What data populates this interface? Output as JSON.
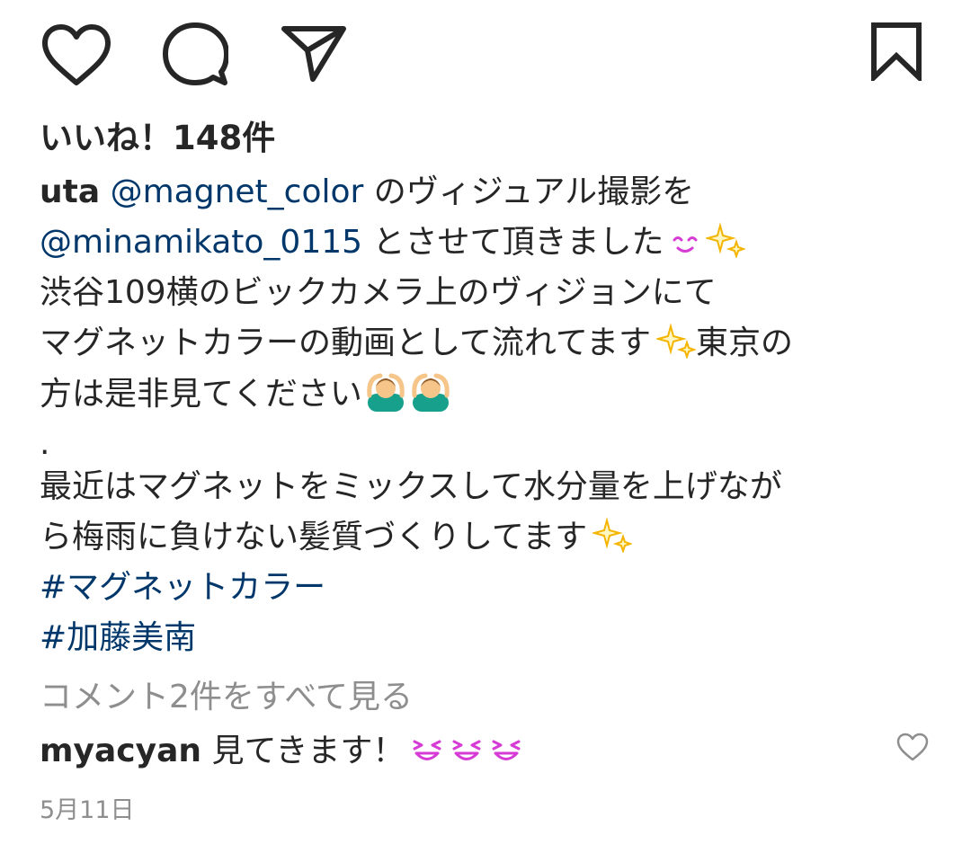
{
  "likes": {
    "text": "いいね！148件"
  },
  "post": {
    "author": "uta",
    "caption_lines": [
      {
        "parts": [
          {
            "type": "mention",
            "text": " @magnet_color"
          },
          {
            "type": "text",
            "text": " のヴィジュアル撮影を"
          }
        ]
      },
      {
        "parts": [
          {
            "type": "mention",
            "text": "@minamikato_0115"
          },
          {
            "type": "text",
            "text": " とさせて頂きました"
          }
        ]
      },
      {
        "text": "渋谷109横のビックカメラ上のヴィジョンにて"
      },
      {
        "text": "マグネットカラーの動画として流れてます"
      },
      {
        "text_after": "東京の"
      },
      {
        "text": "方は是非見てください"
      },
      {
        "text": "."
      },
      {
        "text": "最近はマグネットをミックスして水分量を上げなが"
      },
      {
        "text": "ら梅雨に負けない髪質づくりしてます"
      }
    ],
    "hashtags": [
      "#マグネットカラー",
      "#加藤美南"
    ]
  },
  "view_comments": "コメント2件をすべて見る",
  "comment": {
    "username": "myacyan",
    "text": " 見てきます！"
  },
  "timestamp": "5月11日",
  "icons": {
    "heart": "heart-outline-icon",
    "comment": "comment-bubble-icon",
    "share": "paper-plane-icon",
    "save": "bookmark-icon",
    "comment_like": "small-heart-icon",
    "smile_emoji": "smiling-face-emoji",
    "sparkles_emoji": "sparkles-emoji",
    "person_emoji": "person-gesturing-ok-emoji",
    "grin_emoji": "grinning-squinting-face-emoji"
  },
  "colors": {
    "text": "#262626",
    "link": "#00376b",
    "muted": "#8e8e8e",
    "sparkle": "#f4b400",
    "pink_emoji": "#d63bd6",
    "teal": "#17a08c"
  }
}
